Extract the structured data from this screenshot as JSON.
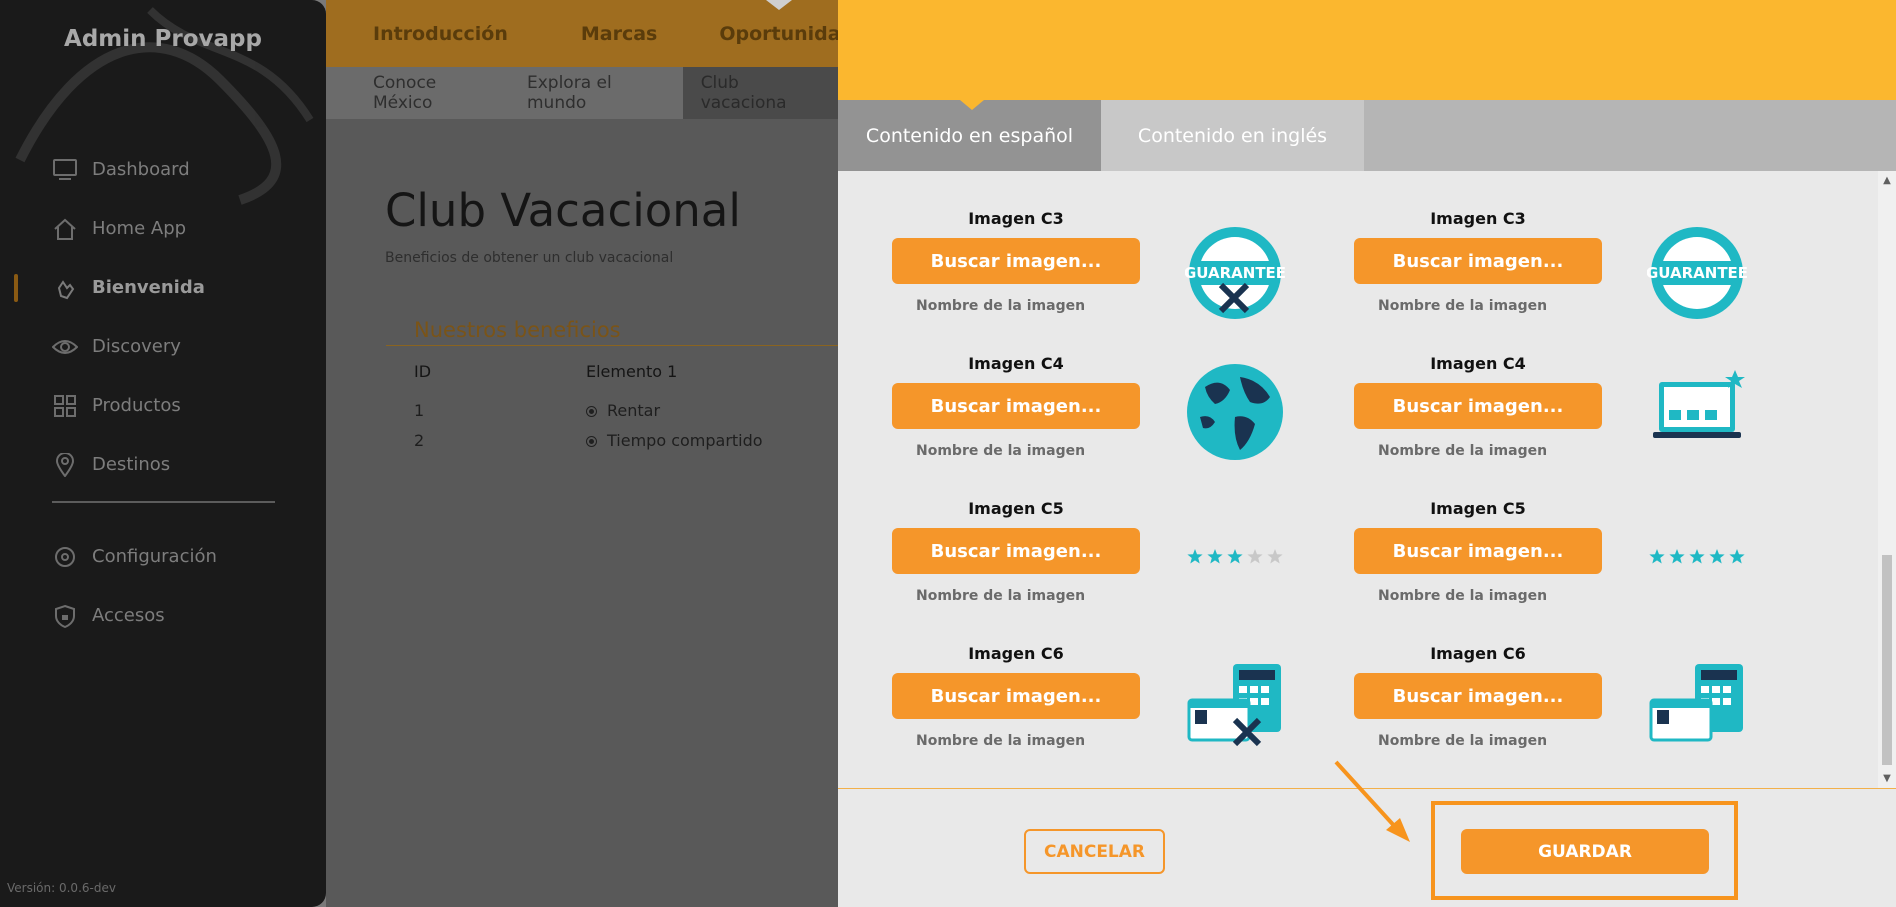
{
  "sidebar": {
    "brand": "Admin Provapp",
    "items": [
      {
        "label": "Dashboard",
        "icon": "monitor-icon"
      },
      {
        "label": "Home App",
        "icon": "home-icon"
      },
      {
        "label": "Bienvenida",
        "icon": "wave-hand-icon",
        "active": true
      },
      {
        "label": "Discovery",
        "icon": "eye-icon"
      },
      {
        "label": "Productos",
        "icon": "grid-icon"
      },
      {
        "label": "Destinos",
        "icon": "location-pin-icon"
      }
    ],
    "items2": [
      {
        "label": "Configuración",
        "icon": "gear-icon"
      },
      {
        "label": "Accesos",
        "icon": "shield-icon"
      }
    ],
    "version": "Versión: 0.0.6-dev"
  },
  "topnav": [
    "Introducción",
    "Marcas",
    "Oportunidade"
  ],
  "subnav": [
    "Conoce México",
    "Explora el mundo",
    "Club vacaciona"
  ],
  "main": {
    "title": "Club Vacacional",
    "subtitle": "Beneficios de obtener un club vacacional",
    "section": "Nuestros beneficios",
    "col_id": "ID",
    "col_el1": "Elemento 1",
    "rows": [
      {
        "id": "1",
        "value": "Rentar"
      },
      {
        "id": "2",
        "value": "Tiempo compartido"
      }
    ]
  },
  "modal": {
    "tabs": [
      "Contenido en español",
      "Contenido en inglés"
    ],
    "button_label": "Buscar imagen...",
    "filename_label": "Nombre de la imagen",
    "rows": [
      {
        "label": "Imagen C3",
        "left_icon": "guarantee-badge-crossed-icon",
        "right_icon": "guarantee-badge-icon"
      },
      {
        "label": "Imagen C4",
        "left_icon": "globe-icon",
        "right_icon": "laptop-icon"
      },
      {
        "label": "Imagen C5",
        "left_icon": "stars-3-of-5-icon",
        "right_icon": "stars-5-of-5-icon",
        "left_rating": 3,
        "right_rating": 5
      },
      {
        "label": "Imagen C6",
        "left_icon": "calculator-card-crossed-icon",
        "right_icon": "calculator-card-icon"
      }
    ],
    "cancel": "CANCELAR",
    "save": "GUARDAR"
  },
  "colors": {
    "accent": "#f5962a",
    "header_yellow": "#fbb72f",
    "teal": "#1fb8c4",
    "navy": "#1a3350"
  }
}
